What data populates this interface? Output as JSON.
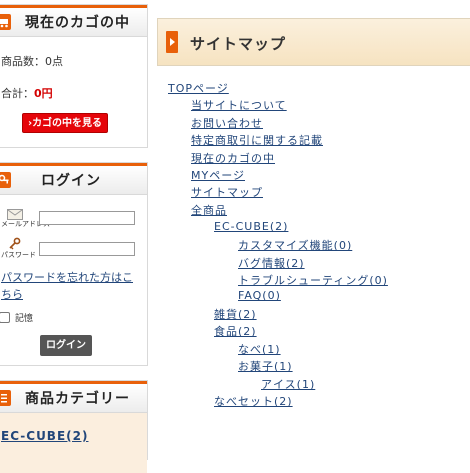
{
  "cart": {
    "title": "現在のカゴの中",
    "count_text": "商品数：0点",
    "total_label": "合計：",
    "total_value": "0円",
    "view_button": "カゴの中を見る"
  },
  "login": {
    "title": "ログイン",
    "email_label": "メールアドレス",
    "password_label": "パスワード",
    "forgot_link": "パスワードを忘れた方はこちら",
    "remember_label": "記憶",
    "login_button": "ログイン"
  },
  "category": {
    "title": "商品カテゴリー",
    "first_item": "EC-CUBE(2)"
  },
  "sitemap": {
    "title": "サイトマップ",
    "links": [
      "TOPページ",
      "当サイトについて",
      "お問い合わせ",
      "特定商取引に関する記載",
      "現在のカゴの中",
      "MYページ",
      "サイトマップ",
      "全商品",
      "EC-CUBE(2)",
      "カスタマイズ機能(0)",
      "バグ情報(2)",
      "トラブルシューティング(0)",
      "FAQ(0)",
      "雑貨(2)",
      "食品(2)",
      "なべ(1)",
      "お菓子(1)",
      "アイス(1)",
      "なべセット(2)"
    ]
  },
  "icons": [
    "cart-icon",
    "key-icon",
    "mail-icon",
    "list-icon",
    "arrow-right-icon"
  ],
  "colors": {
    "accent": "#e8600a",
    "link": "#22467a",
    "price_red": "#d40000",
    "button_red": "#e5050a"
  }
}
